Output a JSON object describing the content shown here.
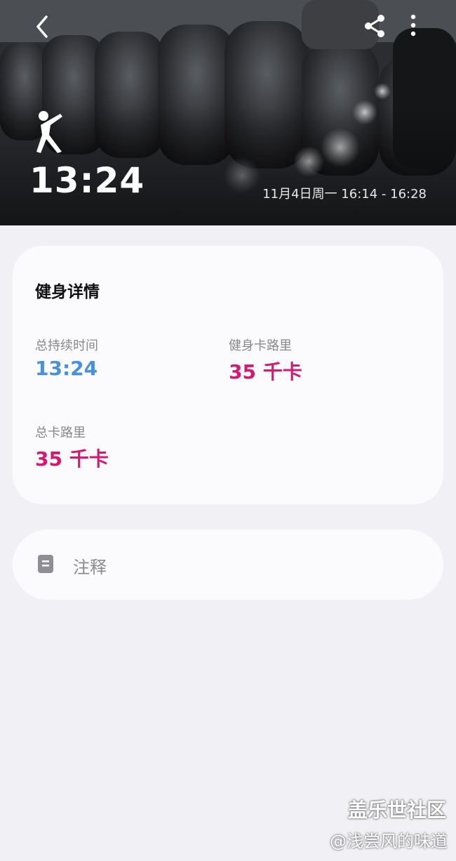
{
  "header": {
    "duration": "13:24",
    "date_range": "11月4日周一 16:14 - 16:28",
    "activity_icon": "stretching-figure-icon",
    "back_icon": "chevron-left-icon",
    "share_icon": "share-icon",
    "more_icon": "more-vertical-icon"
  },
  "details": {
    "title": "健身详情",
    "stats": [
      {
        "label": "总持续时间",
        "value": "13:24",
        "color": "#4a90d9"
      },
      {
        "label": "健身卡路里",
        "value": "35 千卡",
        "color": "#d21a73"
      },
      {
        "label": "总卡路里",
        "value": "35 千卡",
        "color": "#d21a73"
      }
    ]
  },
  "notes": {
    "label": "注释",
    "icon": "note-icon"
  },
  "watermark": {
    "brand": "盖乐世社区",
    "author": "@浅尝风的味道"
  },
  "colors": {
    "background": "#f1f1f5",
    "card": "#fbfbfe",
    "duration_blue": "#4a90d9",
    "calorie_magenta": "#d21a73"
  }
}
